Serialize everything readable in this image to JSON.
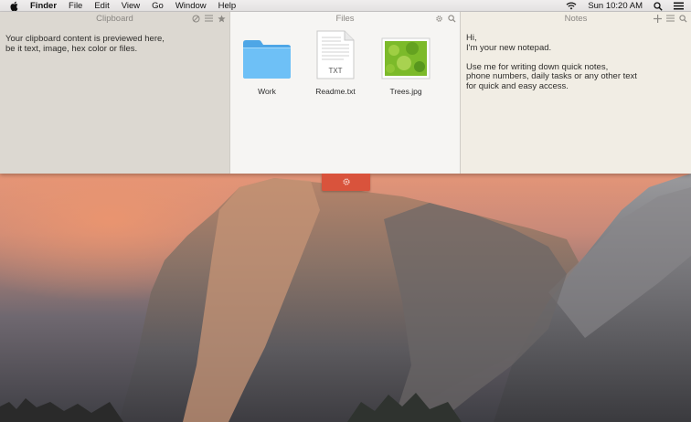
{
  "menubar": {
    "apple_icon": "apple-logo-icon",
    "items": [
      "Finder",
      "File",
      "Edit",
      "View",
      "Go",
      "Window",
      "Help"
    ],
    "clock": "Sun 10:20 AM",
    "status_icons": [
      "wifi-icon",
      "spotlight-search-icon",
      "notification-center-icon"
    ]
  },
  "clipboard": {
    "title": "Clipboard",
    "tools": [
      "clear-icon",
      "list-icon",
      "star-icon"
    ],
    "lines": [
      "Your clipboard content is previewed here,",
      "be it text, image, hex color or files."
    ]
  },
  "files": {
    "title": "Files",
    "tools": [
      "gear-icon",
      "search-icon"
    ],
    "items": [
      {
        "name": "Work",
        "icon": "folder-icon"
      },
      {
        "name": "Readme.txt",
        "icon": "text-document-icon",
        "badge": "TXT"
      },
      {
        "name": "Trees.jpg",
        "icon": "image-thumbnail-icon"
      }
    ]
  },
  "notes": {
    "title": "Notes",
    "tools": [
      "plus-icon",
      "list-icon",
      "search-icon"
    ],
    "lines": [
      "Hi,",
      "I'm your new notepad.",
      "",
      "Use me for writing down quick notes,",
      "phone numbers, daily tasks or any other text",
      "for quick and easy access."
    ]
  },
  "tab": {
    "icon": "gear-icon",
    "color": "#d9533c"
  },
  "colors": {
    "clipboard_bg": "#dcd8d1",
    "files_bg": "#f6f5f3",
    "notes_bg": "#f1ede4",
    "folder_blue": "#62b8f2"
  }
}
